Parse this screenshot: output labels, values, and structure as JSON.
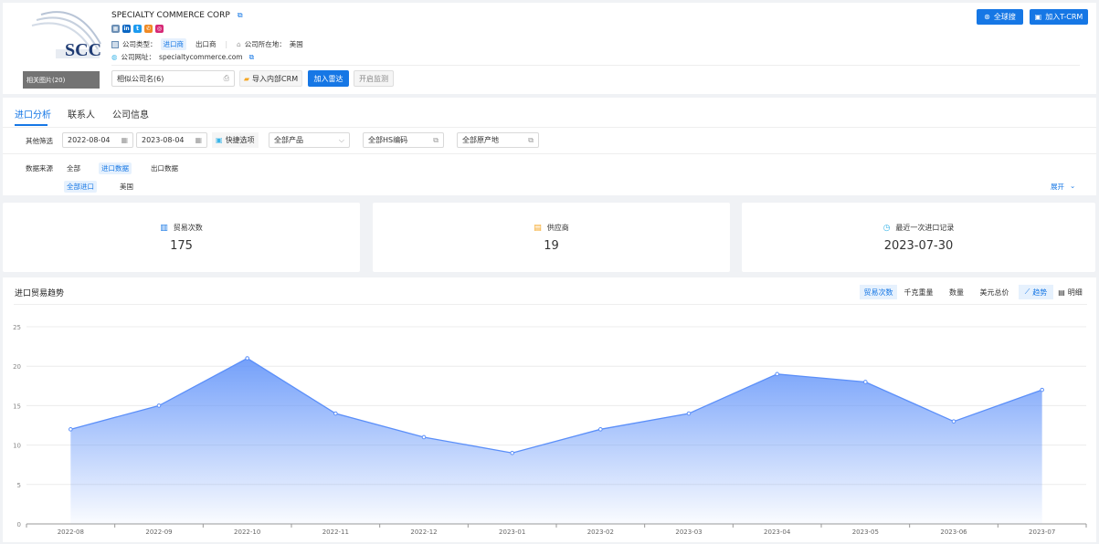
{
  "company": {
    "name": "SPECIALTY COMMERCE CORP",
    "type_label": "公司类型：",
    "type_tags": [
      "进口商",
      "出口商"
    ],
    "location_label": "公司所在地：",
    "location_value": "美国",
    "website_label": "公司网址：",
    "website_value": "specialtycommerce.com",
    "logo_text": "SCC",
    "logo_overlay": "相关图片(20)",
    "similar_placeholder": "相似公司名(6)"
  },
  "actions": {
    "global_search": "全球搜",
    "tcrm": "加入T-CRM",
    "import_crm": "导入内部CRM",
    "add_radar": "加入雷达",
    "open_monitor": "开启监测"
  },
  "tabs": [
    "进口分析",
    "联系人",
    "公司信息"
  ],
  "filters": {
    "label": "其他筛选",
    "date_start": "2022-08-04",
    "date_end": "2023-08-04",
    "quick": "快捷选项",
    "product": "全部产品",
    "hs": "全部HS编码",
    "origin": "全部原产地",
    "source_label": "数据来源",
    "source_options": [
      "全部",
      "进口数据",
      "出口数据"
    ],
    "sub_options": [
      "全部进口",
      "美国"
    ],
    "expand": "展开"
  },
  "stats": [
    {
      "label": "贸易次数",
      "value": "175",
      "icon": "bar-chart-icon",
      "color": "#1677e5"
    },
    {
      "label": "供应商",
      "value": "19",
      "icon": "building-icon",
      "color": "#f5a623"
    },
    {
      "label": "最近一次进口记录",
      "value": "2023-07-30",
      "icon": "clock-icon",
      "color": "#3bb5e8"
    }
  ],
  "trend": {
    "title": "进口贸易趋势",
    "metric_tabs": [
      "贸易次数",
      "千克重量",
      "数量",
      "美元总价"
    ],
    "view_tabs": [
      "趋势",
      "明细"
    ]
  },
  "chart_data": {
    "type": "area",
    "x": [
      "2022-08",
      "2022-09",
      "2022-10",
      "2022-11",
      "2022-12",
      "2023-01",
      "2023-02",
      "2023-03",
      "2023-04",
      "2023-05",
      "2023-06",
      "2023-07"
    ],
    "series": [
      {
        "values": [
          12,
          15,
          21,
          14,
          11,
          9,
          12,
          14,
          19,
          18,
          13,
          17
        ]
      }
    ],
    "ylim": [
      0,
      25
    ],
    "yticks": [
      "0",
      "5",
      "10",
      "15",
      "20",
      "25"
    ],
    "grid": true,
    "color": "#5b8ff9"
  }
}
